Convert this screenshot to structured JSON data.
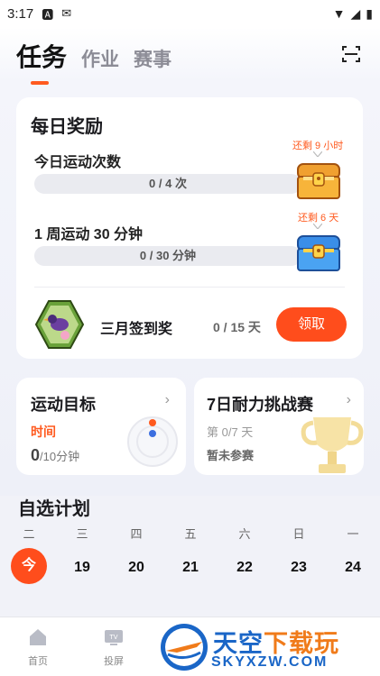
{
  "status_bar": {
    "time": "3:17"
  },
  "tabs": [
    {
      "label": "任务",
      "active": true
    },
    {
      "label": "作业",
      "active": false
    },
    {
      "label": "赛事",
      "active": false
    }
  ],
  "daily": {
    "title": "每日奖励",
    "row1": {
      "label": "今日运动次数",
      "progress": "0 / 4 次",
      "remain": "还剩 9 小时"
    },
    "row2": {
      "label": "1 周运动 30 分钟",
      "progress": "0 / 30 分钟",
      "remain": "还剩 6 天"
    },
    "checkin": {
      "label": "三月签到奖",
      "progress": "0 / 15 天",
      "button": "领取"
    }
  },
  "goal": {
    "title": "运动目标",
    "sub": "时间",
    "value": "0",
    "unit": "/10分钟"
  },
  "challenge": {
    "title": "7日耐力挑战赛",
    "day": "第 0/7 天",
    "status": "暂未参赛"
  },
  "plan": {
    "title": "自选计划",
    "days": [
      {
        "name": "二",
        "num": "今",
        "today": true
      },
      {
        "name": "三",
        "num": "19"
      },
      {
        "name": "四",
        "num": "20"
      },
      {
        "name": "五",
        "num": "21"
      },
      {
        "name": "六",
        "num": "22"
      },
      {
        "name": "日",
        "num": "23"
      },
      {
        "name": "一",
        "num": "24"
      }
    ]
  },
  "nav": [
    {
      "label": "首页"
    },
    {
      "label": "投屏"
    }
  ],
  "watermark": {
    "big1": "天空",
    "big2": "下载玩",
    "small": "SKYXZW.COM"
  },
  "colors": {
    "accent": "#ff4d1c",
    "remain": "#ff5a1f",
    "brand_blue": "#1a66c7"
  }
}
